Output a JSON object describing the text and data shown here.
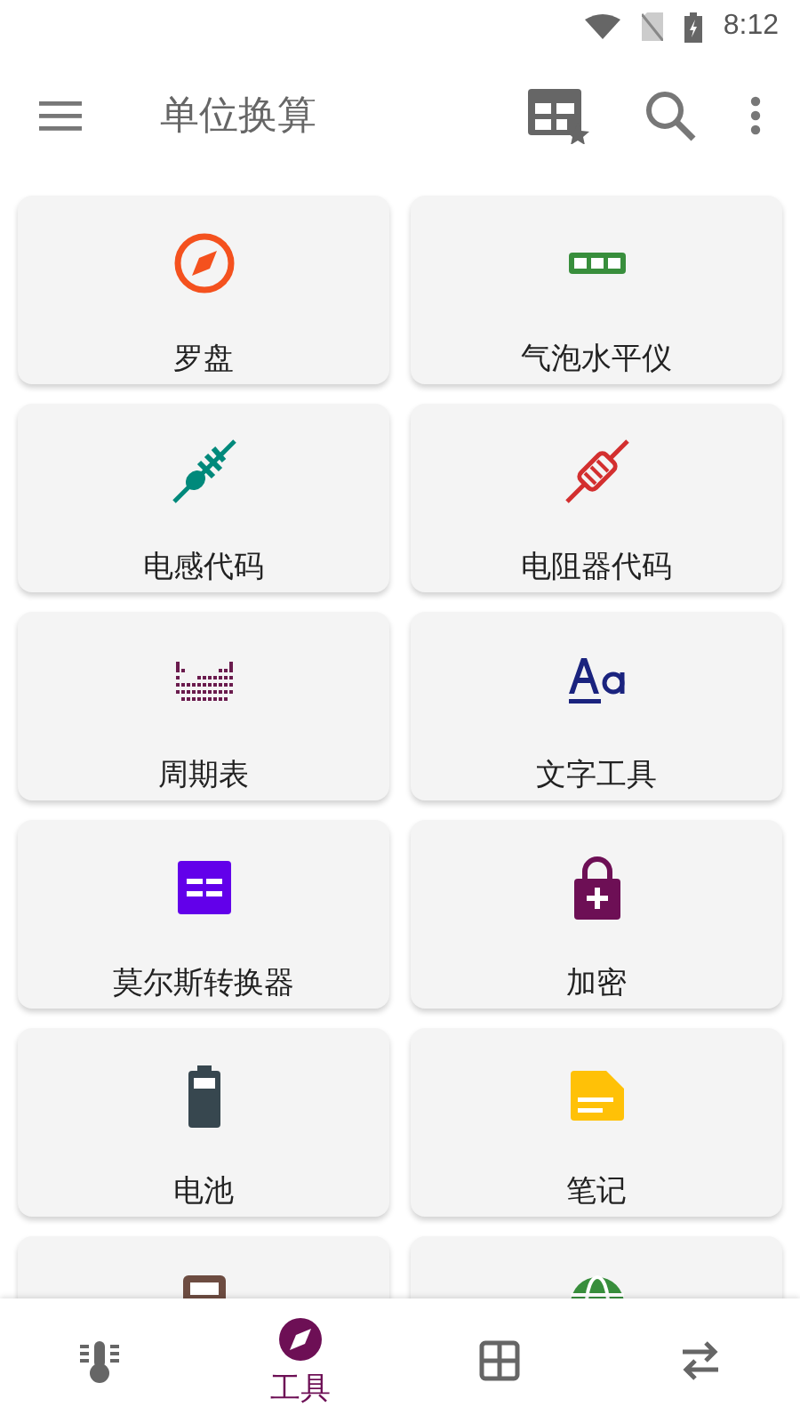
{
  "status_bar": {
    "time": "8:12"
  },
  "app_bar": {
    "title": "单位换算"
  },
  "tools": [
    {
      "label": "罗盘",
      "kind": "compass",
      "color": "#f4511e"
    },
    {
      "label": "气泡水平仪",
      "kind": "level",
      "color": "#388e3c"
    },
    {
      "label": "电感代码",
      "kind": "inductor",
      "color": "#00897b"
    },
    {
      "label": "电阻器代码",
      "kind": "resistor",
      "color": "#d32f2f"
    },
    {
      "label": "周期表",
      "kind": "periodic",
      "color": "#6a1b4d"
    },
    {
      "label": "文字工具",
      "kind": "text",
      "color": "#1a237e"
    },
    {
      "label": "莫尔斯转换器",
      "kind": "morse",
      "color": "#6200ea"
    },
    {
      "label": "加密",
      "kind": "lock",
      "color": "#6d0f55"
    },
    {
      "label": "电池",
      "kind": "battery",
      "color": "#37474f"
    },
    {
      "label": "笔记",
      "kind": "note",
      "color": "#ffc107"
    },
    {
      "kind": "calculator",
      "color": "#6d4c41"
    },
    {
      "kind": "globe",
      "color": "#388e3c"
    }
  ],
  "bottom_nav": [
    {
      "kind": "thermometer",
      "selected": false
    },
    {
      "kind": "compass",
      "label": "工具",
      "selected": true
    },
    {
      "kind": "grid",
      "selected": false
    },
    {
      "kind": "swap",
      "selected": false
    }
  ]
}
